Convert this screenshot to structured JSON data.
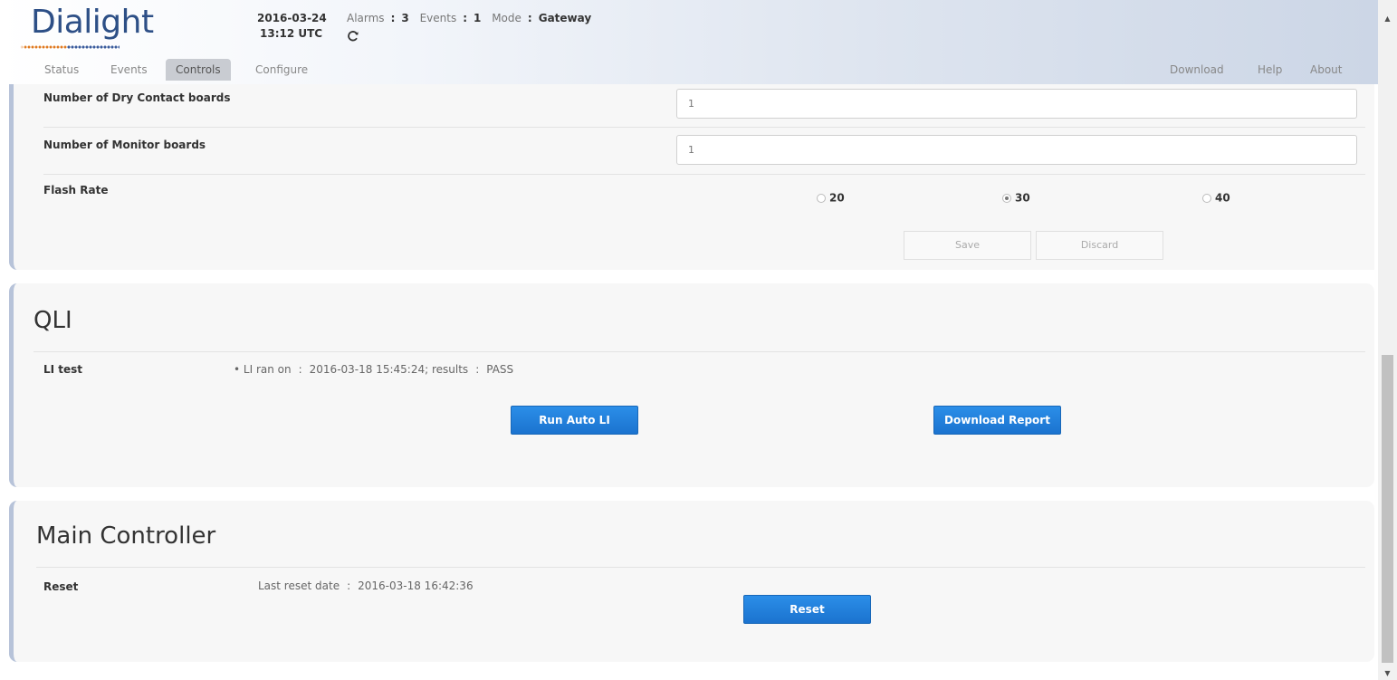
{
  "header": {
    "logo_text": "Dialight",
    "date": "2016-03-24",
    "time": "13:12 UTC",
    "alarms_label": "Alarms",
    "alarms_value": "3",
    "events_label": "Events",
    "events_value": "1",
    "mode_label": "Mode",
    "mode_value": "Gateway",
    "separator": ":"
  },
  "nav": {
    "left": [
      {
        "label": "Status",
        "active": false
      },
      {
        "label": "Events",
        "active": false
      },
      {
        "label": "Controls",
        "active": true
      },
      {
        "label": "Configure",
        "active": false
      }
    ],
    "right": [
      {
        "label": "Download"
      },
      {
        "label": "Help"
      },
      {
        "label": "About"
      }
    ]
  },
  "settings": {
    "dry_contact_label": "Number of Dry Contact boards",
    "dry_contact_value": "1",
    "monitor_label": "Number of Monitor boards",
    "monitor_value": "1",
    "flash_rate_label": "Flash Rate",
    "flash_rate_options": [
      "20",
      "30",
      "40"
    ],
    "flash_rate_selected": "30",
    "save_label": "Save",
    "discard_label": "Discard"
  },
  "qli": {
    "title": "QLI",
    "test_label": "LI test",
    "bullet": "•",
    "ran_on_label": "LI ran on",
    "ran_on_value": "2016-03-18 15:45:24;",
    "results_label": "results",
    "results_value": "PASS",
    "separator": ":",
    "run_button": "Run Auto LI",
    "download_button": "Download Report"
  },
  "main_controller": {
    "title": "Main Controller",
    "reset_label": "Reset",
    "last_reset_label": "Last reset date",
    "last_reset_value": "2016-03-18 16:42:36",
    "separator": ":",
    "reset_button": "Reset"
  },
  "icons": {
    "refresh": "refresh-icon",
    "scroll_up": "scroll-up-arrow-icon",
    "scroll_down": "scroll-down-arrow-icon"
  },
  "colors": {
    "brand_blue": "#2d4f86",
    "brand_orange": "#e07a20",
    "button_blue": "#1b73cf",
    "panel_accent": "#b7c3d9",
    "panel_bg": "#f7f7f7"
  }
}
